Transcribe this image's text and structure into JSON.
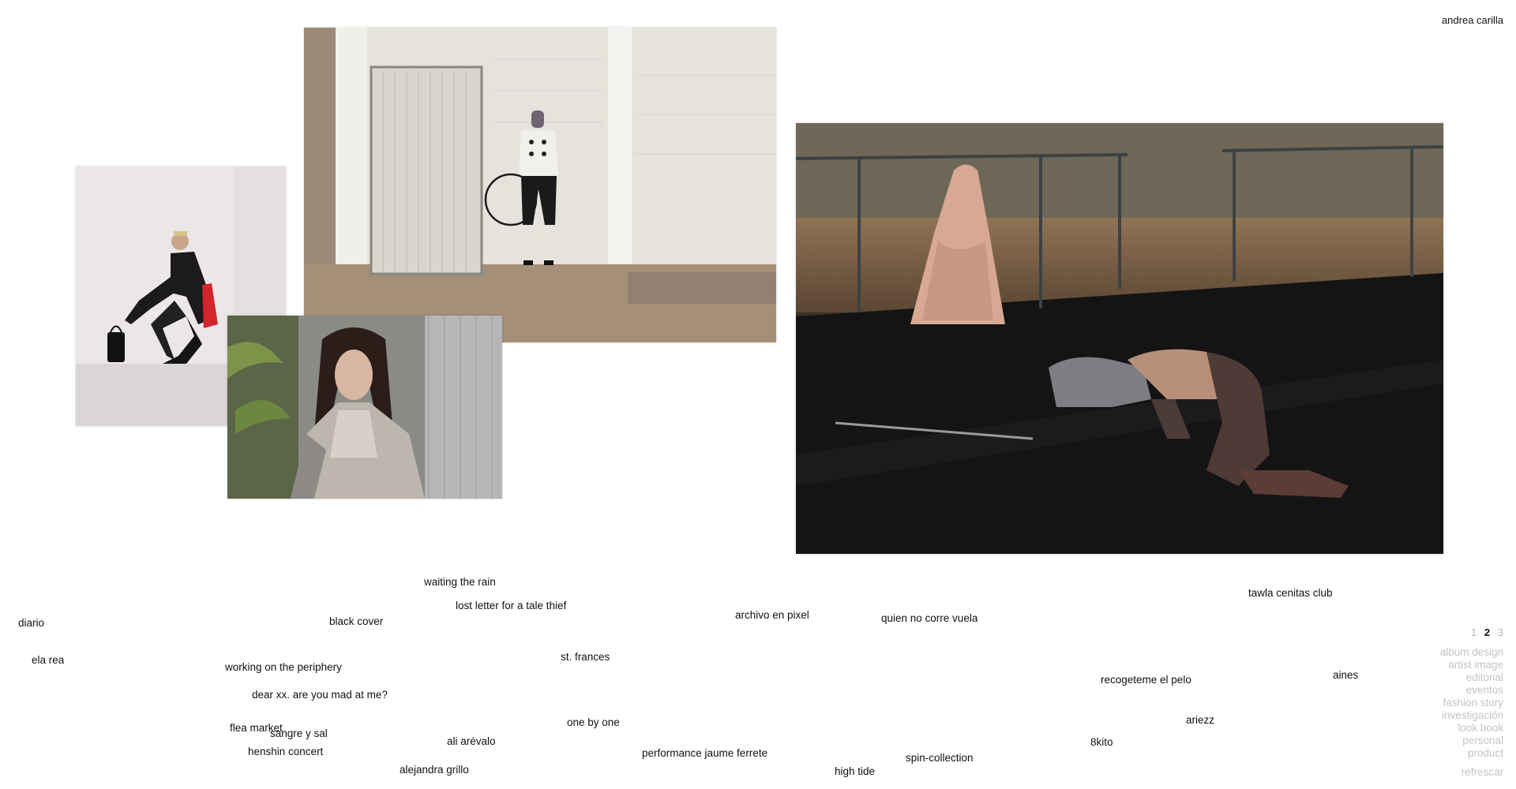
{
  "site": {
    "title": "andrea carilla"
  },
  "projects": [
    {
      "label": "waiting the rain"
    },
    {
      "label": "lost letter for a tale thief"
    },
    {
      "label": "archivo en pixel"
    },
    {
      "label": "quien no corre vuela"
    },
    {
      "label": "tawla cenitas club"
    },
    {
      "label": "diario"
    },
    {
      "label": "black cover"
    },
    {
      "label": "ela rea"
    },
    {
      "label": "working on the periphery"
    },
    {
      "label": "st. frances"
    },
    {
      "label": "dear xx. are you mad at me?"
    },
    {
      "label": "recogeteme el pelo"
    },
    {
      "label": "aines"
    },
    {
      "label": "flea market"
    },
    {
      "label": "sangre y sal"
    },
    {
      "label": "one by one"
    },
    {
      "label": "ariezz"
    },
    {
      "label": "ali arévalo"
    },
    {
      "label": "8kito"
    },
    {
      "label": "henshin concert"
    },
    {
      "label": "performance jaume ferrete"
    },
    {
      "label": "spin-collection"
    },
    {
      "label": "alejandra grillo"
    },
    {
      "label": "high tide"
    }
  ],
  "pager": {
    "pages": [
      "1",
      "2",
      "3"
    ],
    "current": "2"
  },
  "categories": [
    "album design",
    "artist image",
    "editorial",
    "eventos",
    "fashion story",
    "investigación",
    "look book",
    "personal",
    "product"
  ],
  "refresh_label": "refrescar"
}
